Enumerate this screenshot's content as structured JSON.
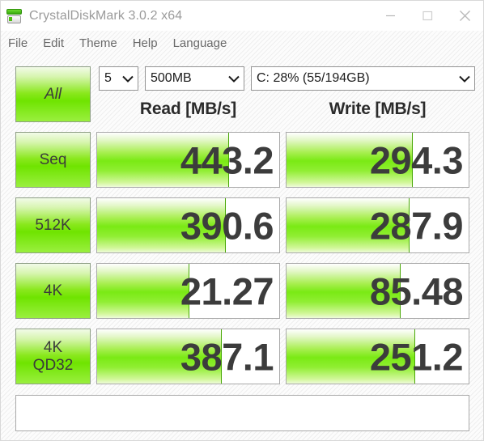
{
  "window": {
    "title": "CrystalDiskMark 3.0.2 x64",
    "icon": "disk-drive-icon",
    "controls": {
      "minimize": "minimize-icon",
      "maximize": "maximize-icon",
      "close": "close-icon"
    }
  },
  "menu": {
    "items": [
      {
        "label": "File"
      },
      {
        "label": "Edit"
      },
      {
        "label": "Theme"
      },
      {
        "label": "Help"
      },
      {
        "label": "Language"
      }
    ]
  },
  "toolbar": {
    "runs": {
      "value": "5"
    },
    "size": {
      "value": "500MB"
    },
    "drive": {
      "value": "C: 28% (55/194GB)"
    },
    "arrow_icon": "chevron-down-icon"
  },
  "headers": {
    "read": "Read [MB/s]",
    "write": "Write [MB/s]"
  },
  "buttons": {
    "all": "All"
  },
  "comment": {
    "value": ""
  },
  "colors": {
    "bar_green": "#7aea14",
    "button_green": "#6fe400",
    "text_dark": "#3c3c3c",
    "title_gray": "#9b9b9b"
  },
  "chart_data": {
    "type": "bar",
    "title": "CrystalDiskMark 3.0.2 x64 benchmark results",
    "xlabel": "",
    "ylabel": "MB/s",
    "categories": [
      "Seq",
      "512K",
      "4K",
      "4K QD32"
    ],
    "series": [
      {
        "name": "Read [MB/s]",
        "values": [
          443.2,
          390.6,
          21.27,
          387.1
        ]
      },
      {
        "name": "Write [MB/s]",
        "values": [
          294.3,
          287.9,
          85.48,
          251.2
        ]
      }
    ],
    "bar_fill_percent": {
      "read": [
        72,
        70,
        50,
        68
      ],
      "write": [
        69,
        67,
        62,
        70
      ]
    },
    "legend": "left-column-buttons",
    "grid": false
  },
  "rows": [
    {
      "button": "Seq",
      "button_sub": "",
      "read": "443.2",
      "write": "294.3",
      "read_fill": 72,
      "write_fill": 69
    },
    {
      "button": "512K",
      "button_sub": "",
      "read": "390.6",
      "write": "287.9",
      "read_fill": 70,
      "write_fill": 67
    },
    {
      "button": "4K",
      "button_sub": "",
      "read": "21.27",
      "write": "85.48",
      "read_fill": 50,
      "write_fill": 62
    },
    {
      "button": "4K",
      "button_sub": "QD32",
      "read": "387.1",
      "write": "251.2",
      "read_fill": 68,
      "write_fill": 70
    }
  ]
}
